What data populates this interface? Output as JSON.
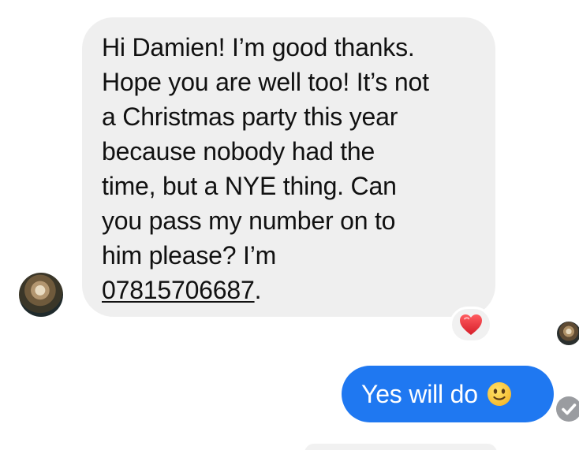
{
  "conversation": {
    "incoming_message": {
      "text_before_phone": "Hi Damien! I’m good thanks.\nHope you are well too! It’s not\na Christmas party this year\nbecause nobody had the\ntime, but a NYE thing. Can\nyou pass my number on to\nhim please? I’m\n",
      "phone_number": "07815706687",
      "text_after_phone": ".",
      "reaction_icon": "red-heart-icon"
    },
    "outgoing_message": {
      "text": "Yes will do",
      "emoji_icon": "slightly-smiling-face-icon"
    },
    "status_icon": "delivered-check-icon",
    "colors": {
      "incoming_bubble": "#efefef",
      "outgoing_bubble": "#1f78f1",
      "text_dark": "#111111",
      "text_light": "#ffffff",
      "reaction_heart": "#e8262d",
      "status_grey": "#9a9ca0"
    }
  }
}
